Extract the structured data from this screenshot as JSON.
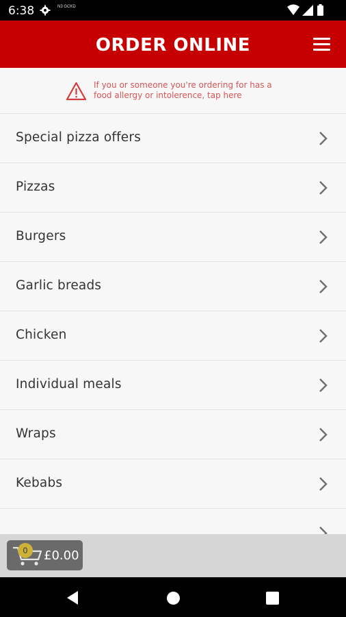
{
  "status_bar": {
    "time": "6:38",
    "small_icon_text": "N3 GCKD"
  },
  "header": {
    "title": "ORDER ONLINE"
  },
  "allergy_notice": {
    "text": "If you or someone you're ordering for has a food allergy or intolerence, tap here"
  },
  "menu": {
    "items": [
      {
        "label": "Special pizza offers"
      },
      {
        "label": "Pizzas"
      },
      {
        "label": "Burgers"
      },
      {
        "label": "Garlic breads"
      },
      {
        "label": "Chicken"
      },
      {
        "label": "Individual meals"
      },
      {
        "label": "Wraps"
      },
      {
        "label": "Kebabs"
      },
      {
        "label": ""
      }
    ]
  },
  "cart": {
    "count": "0",
    "total": "£0.00"
  },
  "colors": {
    "brand": "#c60000",
    "warning": "#d55555",
    "badge": "#cdb23a"
  }
}
